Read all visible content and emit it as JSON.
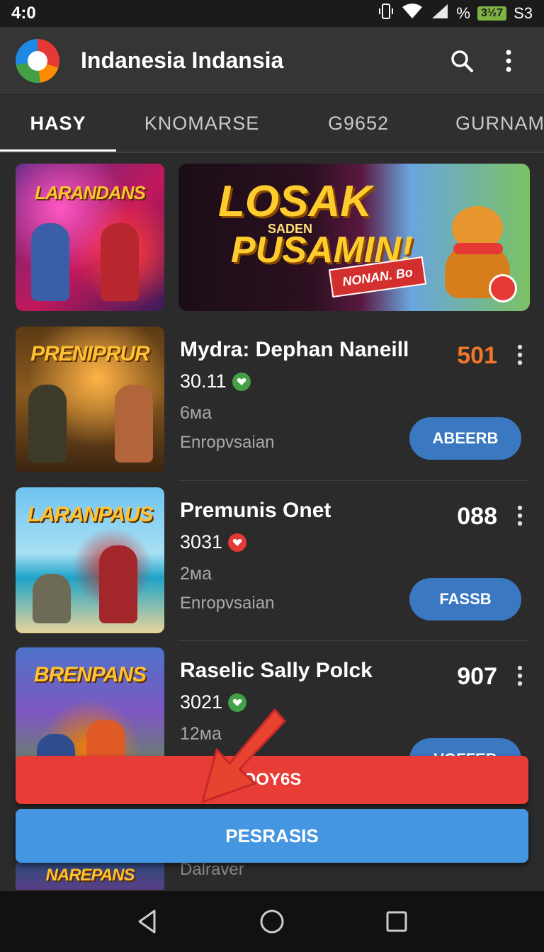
{
  "status_bar": {
    "time": "4:0",
    "signal_text": "%",
    "battery_text": "3½7",
    "extra_text": "S3"
  },
  "app_bar": {
    "title": "Indanesia Indansia",
    "icons": [
      "app-logo",
      "search-icon",
      "more-vertical-icon"
    ]
  },
  "tabs": [
    {
      "label": "HASY",
      "active": true
    },
    {
      "label": "KNOMARSE",
      "active": false
    },
    {
      "label": "G9652",
      "active": false
    },
    {
      "label": "GURNAM",
      "active": false
    }
  ],
  "featured": {
    "thumb_title": "LARANDANS",
    "banner_line1": "LOSAK",
    "banner_line2": "SADEN",
    "banner_line3": "PUSAMIN!",
    "banner_tag": "NONAN. Bo"
  },
  "games": [
    {
      "thumb_title": "PRENIPRUR",
      "title": "Mydra: Dephan Naneill",
      "score": "501",
      "score_color": "#f0762a",
      "count": "30.11",
      "badge": "green",
      "size": "6ма",
      "category": "Enropvsaian",
      "button": "ABEERB"
    },
    {
      "thumb_title": "LARANPAUS",
      "title": "Premunis Onet",
      "score": "088",
      "score_color": "#ffffff",
      "count": "3031",
      "badge": "red",
      "size": "2ма",
      "category": "Enropvsaian",
      "button": "FASSB"
    },
    {
      "thumb_title": "BRENPANS",
      "title": "Raselic Sally Polck",
      "score": "907",
      "score_color": "#ffffff",
      "count": "3021",
      "badge": "green",
      "size": "12ма",
      "category": "",
      "button": "VOFFEB"
    }
  ],
  "partial": {
    "thumb_title": "NAREPANS",
    "text": "Dalraver"
  },
  "actions": {
    "red_label": "OOY6S",
    "blue_label": "PESRASIS"
  },
  "nav": [
    "back-icon",
    "home-icon",
    "recents-icon"
  ]
}
